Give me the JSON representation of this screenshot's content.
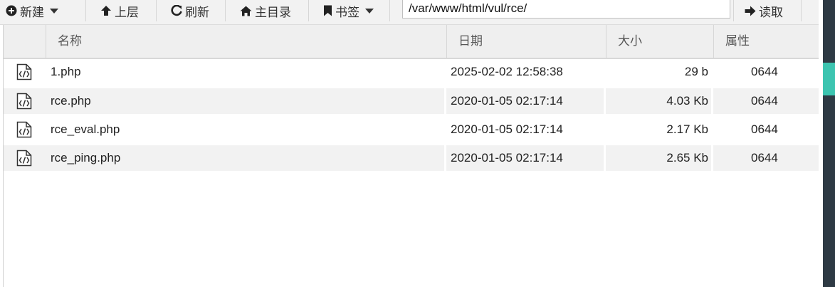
{
  "toolbar": {
    "new_label": "新建",
    "up_label": "上层",
    "refresh_label": "刷新",
    "home_label": "主目录",
    "bookmark_label": "书签",
    "address_value": "/var/www/html/vul/rce/",
    "read_label": "读取"
  },
  "table": {
    "headers": {
      "name": "名称",
      "date": "日期",
      "size": "大小",
      "attr": "属性"
    },
    "rows": [
      {
        "name": "1.php",
        "date": "2025-02-02 12:58:38",
        "size": "29 b",
        "attr": "0644"
      },
      {
        "name": "rce.php",
        "date": "2020-01-05 02:17:14",
        "size": "4.03 Kb",
        "attr": "0644"
      },
      {
        "name": "rce_eval.php",
        "date": "2020-01-05 02:17:14",
        "size": "2.17 Kb",
        "attr": "0644"
      },
      {
        "name": "rce_ping.php",
        "date": "2020-01-05 02:17:14",
        "size": "2.65 Kb",
        "attr": "0644"
      }
    ]
  },
  "icons": {
    "new": "plus-circle-icon",
    "up": "arrow-up-icon",
    "refresh": "refresh-icon",
    "home": "home-icon",
    "bookmark": "bookmark-icon",
    "read": "arrow-right-icon",
    "file": "code-file-icon"
  },
  "colors": {
    "accent": "#3cc4b0",
    "edge": "#2e3a44",
    "toolbar_bg": "#f2f2f2",
    "row_alt": "#f2f2f2"
  }
}
